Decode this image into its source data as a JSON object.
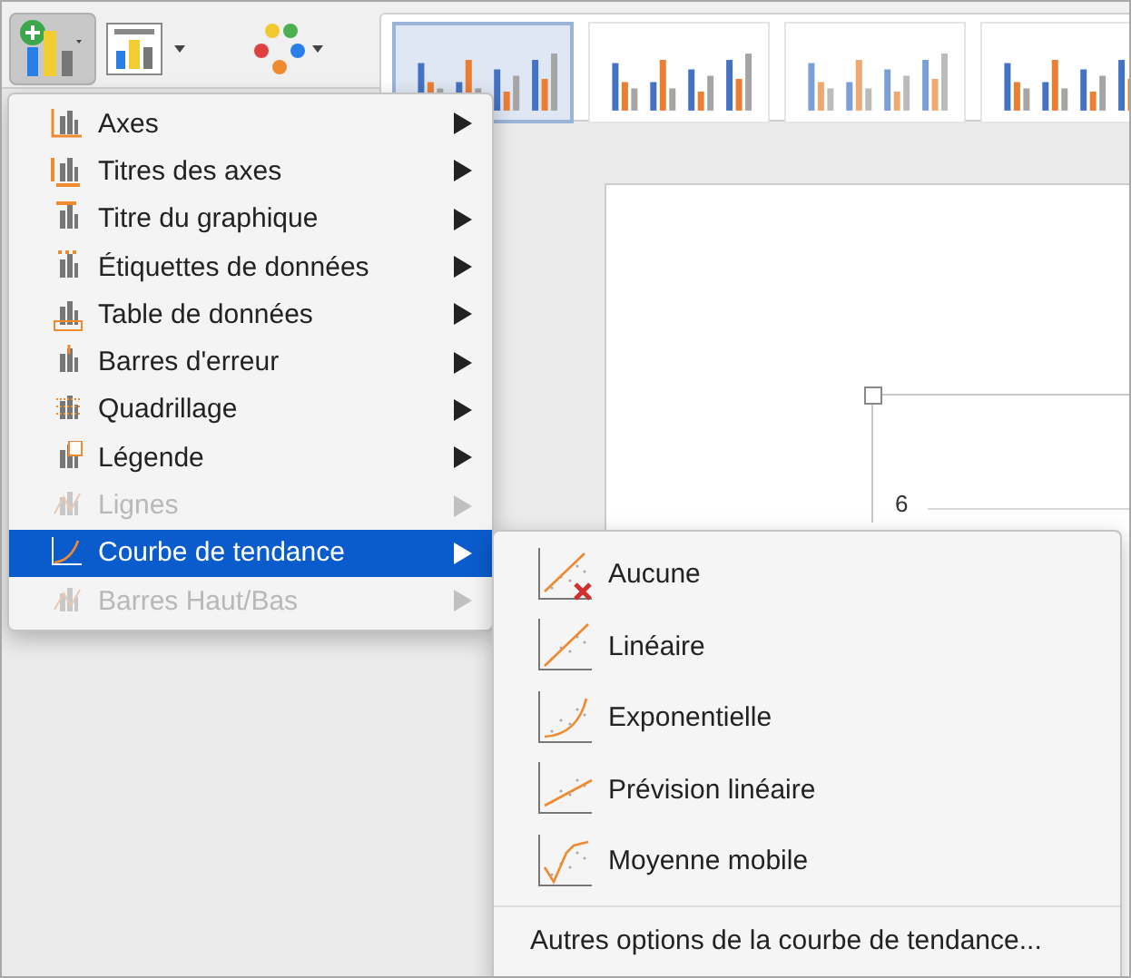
{
  "toolbar": {
    "add_element_pressed": true,
    "styles": [
      {
        "selected": true
      },
      {
        "selected": false
      },
      {
        "selected": false
      },
      {
        "selected": false
      }
    ]
  },
  "slide": {
    "axis_label": "6"
  },
  "menu": {
    "items": [
      {
        "label": "Axes",
        "disabled": false,
        "selected": false
      },
      {
        "label": "Titres des axes",
        "disabled": false,
        "selected": false
      },
      {
        "label": "Titre du graphique",
        "disabled": false,
        "selected": false
      },
      {
        "label": "Étiquettes de données",
        "disabled": false,
        "selected": false
      },
      {
        "label": "Table de données",
        "disabled": false,
        "selected": false
      },
      {
        "label": "Barres d'erreur",
        "disabled": false,
        "selected": false
      },
      {
        "label": "Quadrillage",
        "disabled": false,
        "selected": false
      },
      {
        "label": "Légende",
        "disabled": false,
        "selected": false
      },
      {
        "label": "Lignes",
        "disabled": true,
        "selected": false
      },
      {
        "label": "Courbe de tendance",
        "disabled": false,
        "selected": true
      },
      {
        "label": "Barres Haut/Bas",
        "disabled": true,
        "selected": false
      }
    ]
  },
  "submenu": {
    "items": [
      {
        "label": "Aucune",
        "kind": "none"
      },
      {
        "label": "Linéaire",
        "kind": "linear"
      },
      {
        "label": "Exponentielle",
        "kind": "exponential"
      },
      {
        "label": "Prévision linéaire",
        "kind": "forecast"
      },
      {
        "label": "Moyenne mobile",
        "kind": "moving"
      }
    ],
    "footer": "Autres options de la courbe de tendance..."
  }
}
